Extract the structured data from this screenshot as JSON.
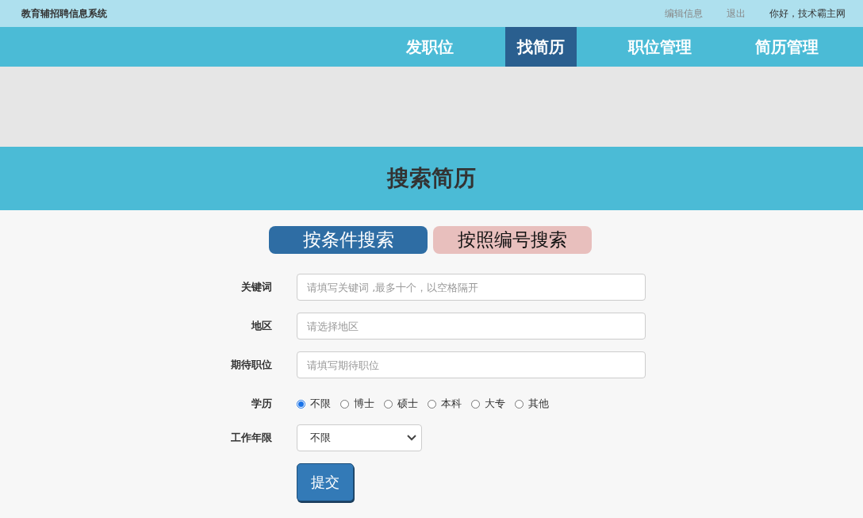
{
  "top_bar": {
    "system_name": "教育辅招聘信息系统",
    "links": [
      {
        "label": "编辑信息"
      },
      {
        "label": "退出"
      }
    ],
    "greeting": "你好，技术霸主网"
  },
  "nav": [
    {
      "label": "发职位",
      "selected": false
    },
    {
      "label": "找简历",
      "selected": true
    },
    {
      "label": "职位管理",
      "selected": false
    },
    {
      "label": "简历管理",
      "selected": false
    }
  ],
  "page_title": "搜索简历",
  "search_tabs": [
    {
      "label": "按条件搜索",
      "selected": true
    },
    {
      "label": "按照编号搜索",
      "selected": false
    }
  ],
  "form": {
    "fields": [
      {
        "label": "关键词",
        "placeholder": "请填写关键词 ,最多十个，以空格隔开"
      },
      {
        "label": "地区",
        "placeholder": "请选择地区"
      },
      {
        "label": "期待职位",
        "placeholder": "请填写期待职位"
      }
    ],
    "education": {
      "label": "学历",
      "options": [
        {
          "label": "不限",
          "selected": true
        },
        {
          "label": "博士",
          "selected": false
        },
        {
          "label": "硕士",
          "selected": false
        },
        {
          "label": "本科",
          "selected": false
        },
        {
          "label": "大专",
          "selected": false
        },
        {
          "label": "其他",
          "selected": false
        }
      ]
    },
    "work_years": {
      "label": "工作年限",
      "value": "不限"
    },
    "submit": "提交"
  }
}
